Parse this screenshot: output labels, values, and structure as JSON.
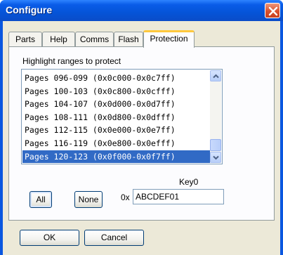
{
  "window": {
    "title": "Configure",
    "close_icon": "close-icon"
  },
  "tabs": [
    {
      "label": "Parts",
      "active": false
    },
    {
      "label": "Help",
      "active": false
    },
    {
      "label": "Comms",
      "active": false
    },
    {
      "label": "Flash",
      "active": false
    },
    {
      "label": "Protection",
      "active": true
    }
  ],
  "protection": {
    "label": "Highlight ranges to protect",
    "ranges": [
      {
        "text": "Pages 096-099 (0x0c000-0x0c7ff)",
        "selected": false
      },
      {
        "text": "Pages 100-103 (0x0c800-0x0cfff)",
        "selected": false
      },
      {
        "text": "Pages 104-107 (0x0d000-0x0d7ff)",
        "selected": false
      },
      {
        "text": "Pages 108-111 (0x0d800-0x0dfff)",
        "selected": false
      },
      {
        "text": "Pages 112-115 (0x0e000-0x0e7ff)",
        "selected": false
      },
      {
        "text": "Pages 116-119 (0x0e800-0x0efff)",
        "selected": false
      },
      {
        "text": "Pages 120-123 (0x0f000-0x0f7ff)",
        "selected": true
      }
    ],
    "all_label": "All",
    "none_label": "None",
    "key_label": "Key0",
    "hex_prefix": "0x",
    "key_value": "ABCDEF01"
  },
  "footer": {
    "ok_label": "OK",
    "cancel_label": "Cancel"
  },
  "colors": {
    "titlebar": "#0a5ce8",
    "selection": "#316ac5",
    "active_tab_highlight": "#ffc83c",
    "close_button": "#d8502c"
  }
}
